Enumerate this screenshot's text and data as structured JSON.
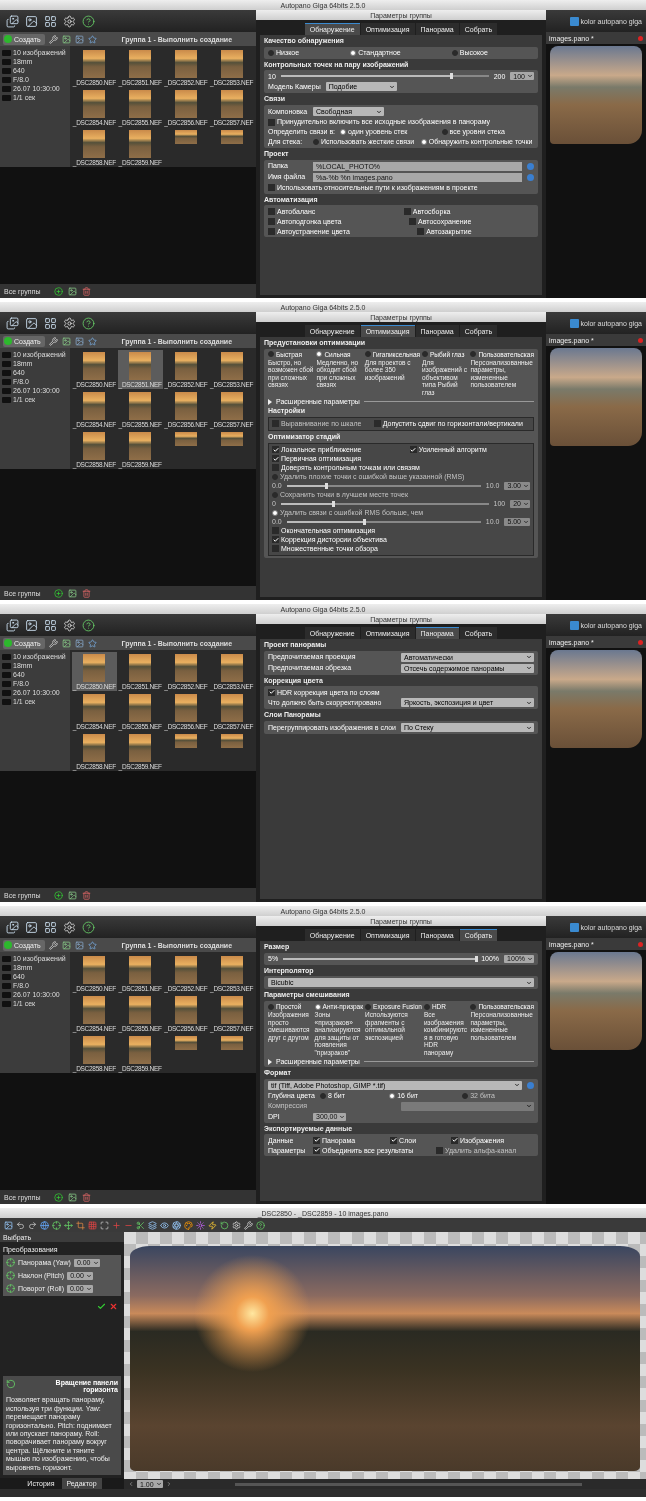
{
  "screens": [
    {
      "kind": "group-settings",
      "window_title": "Autopano Giga 64bits 2.5.0",
      "group_button": "Создать",
      "group_title": "Группа 1 - Выполнить создание",
      "info": [
        "10 изображений",
        "18mm",
        "640",
        "F/8.0",
        "26.07 10:30:00",
        "1/1 сек"
      ],
      "thumbnails": [
        {
          "label": "_DSC2850.NEF",
          "selected": false
        },
        {
          "label": "_DSC2851.NEF",
          "selected": false
        },
        {
          "label": "_DSC2852.NEF",
          "selected": false
        },
        {
          "label": "_DSC2853.NEF",
          "selected": false
        },
        {
          "label": "_DSC2854.NEF",
          "selected": false
        },
        {
          "label": "_DSC2855.NEF",
          "selected": false
        },
        {
          "label": "_DSC2856.NEF",
          "selected": false
        },
        {
          "label": "_DSC2857.NEF",
          "selected": false
        },
        {
          "label": "_DSC2858.NEF",
          "selected": false
        },
        {
          "label": "_DSC2859.NEF",
          "selected": false
        }
      ],
      "footer_label": "Все группы",
      "logo": "kolor autopano giga",
      "preview_title": "images.pano *",
      "dialog": {
        "title": "Параметры группы",
        "tabs": [
          {
            "label": "Обнаружение",
            "selected": true
          },
          {
            "label": "Оптимизация",
            "selected": false
          },
          {
            "label": "Панорама",
            "selected": false
          },
          {
            "label": "Собрать",
            "selected": false
          }
        ],
        "sections": [
          {
            "title": "Качество обнаружения",
            "rows": [
              {
                "kind": "radios",
                "options": [
                  {
                    "label": "Низкое",
                    "selected": false
                  },
                  {
                    "label": "Стандартное",
                    "selected": true
                  },
                  {
                    "label": "Высокое",
                    "selected": false
                  }
                ]
              }
            ]
          },
          {
            "title": "Контрольных точек на пару изображений",
            "rows": [
              {
                "kind": "slider",
                "min": "10",
                "max": "200",
                "level": 0.82,
                "value": "100"
              },
              {
                "kind": "select",
                "label": "Модель Камеры",
                "value": "Подобие",
                "narrow": true
              }
            ]
          },
          {
            "title": "Связи",
            "rows": [
              {
                "kind": "select",
                "label": "Компоновка",
                "value": "Свободная",
                "narrow": true
              },
              {
                "kind": "checks",
                "items": [
                  {
                    "label": "Принудительно включить все исходные изображения в панораму",
                    "checked": false
                  }
                ]
              },
              {
                "kind": "radios",
                "label": "Определить связи в:",
                "options": [
                  {
                    "label": "один уровень стек",
                    "selected": true
                  },
                  {
                    "label": "все уровни стека",
                    "selected": false
                  }
                ]
              },
              {
                "kind": "radios",
                "label": "Для стека:",
                "options": [
                  {
                    "label": "Использовать жесткие связи",
                    "selected": false
                  },
                  {
                    "label": "Обнаружить контрольные точки",
                    "selected": true
                  }
                ]
              }
            ]
          },
          {
            "title": "Проект",
            "rows": [
              {
                "kind": "field",
                "label": "Папка",
                "value": "%LOCAL_PHOTO%"
              },
              {
                "kind": "field",
                "label": "Имя файла",
                "value": "%a-%b %n images.pano"
              },
              {
                "kind": "checks",
                "items": [
                  {
                    "label": "Использовать относительные пути к изображениям в проекте",
                    "checked": false
                  }
                ]
              }
            ]
          },
          {
            "title": "Автоматизация",
            "rows": [
              {
                "kind": "checks",
                "items": [
                  {
                    "label": "Автобаланс",
                    "checked": false
                  },
                  {
                    "label": "Автосборка",
                    "checked": false
                  }
                ]
              },
              {
                "kind": "checks",
                "items": [
                  {
                    "label": "Автоподгонка цвета",
                    "checked": false
                  },
                  {
                    "label": "Автосохранение",
                    "checked": false
                  }
                ]
              },
              {
                "kind": "checks",
                "items": [
                  {
                    "label": "Автоустранение цвета",
                    "checked": false
                  },
                  {
                    "label": "Автозакрытие",
                    "checked": false
                  }
                ]
              }
            ]
          }
        ]
      }
    },
    {
      "kind": "group-settings",
      "window_title": "Autopano Giga 64bits 2.5.0",
      "group_button": "Создать",
      "group_title": "Группа 1 - Выполнить создание",
      "info": [
        "10 изображений",
        "18mm",
        "640",
        "F/8.0",
        "26.07 10:30:00",
        "1/1 сек"
      ],
      "thumbnails": [
        {
          "label": "_DSC2850.NEF",
          "selected": false
        },
        {
          "label": "_DSC2851.NEF",
          "selected": true
        },
        {
          "label": "_DSC2852.NEF",
          "selected": false
        },
        {
          "label": "_DSC2853.NEF",
          "selected": false
        },
        {
          "label": "_DSC2854.NEF",
          "selected": false
        },
        {
          "label": "_DSC2855.NEF",
          "selected": false
        },
        {
          "label": "_DSC2856.NEF",
          "selected": false
        },
        {
          "label": "_DSC2857.NEF",
          "selected": false
        },
        {
          "label": "_DSC2858.NEF",
          "selected": false
        },
        {
          "label": "_DSC2859.NEF",
          "selected": false
        }
      ],
      "footer_label": "Все группы",
      "logo": "kolor autopano giga",
      "preview_title": "images.pano *",
      "dialog": {
        "title": "Параметры группы",
        "tabs": [
          {
            "label": "Обнаружение",
            "selected": false
          },
          {
            "label": "Оптимизация",
            "selected": true
          },
          {
            "label": "Панорама",
            "selected": false
          },
          {
            "label": "Собрать",
            "selected": false
          }
        ],
        "sections": [
          {
            "title": "Предустановки оптимизации",
            "rows": [
              {
                "kind": "presets",
                "options": [
                  {
                    "label": "Быстрая",
                    "selected": false,
                    "description": "Быстро, но возможен сбой при сложных связях"
                  },
                  {
                    "label": "Сильная",
                    "selected": true,
                    "description": "Медленно, но обходит сбой при сложных связях"
                  },
                  {
                    "label": "Гигапиксельная",
                    "selected": false,
                    "description": "Для проектов с более 350 изображений"
                  },
                  {
                    "label": "Рыбий глаз",
                    "selected": false,
                    "description": "Для изображений с объективом типа Рыбий глаз"
                  },
                  {
                    "label": "Пользовательская",
                    "selected": false,
                    "description": "Персонализованные параметры, измененные пользователем"
                  }
                ]
              },
              {
                "kind": "expander",
                "label": "Расширенные параметры"
              },
              {
                "kind": "group",
                "title": "Настройки",
                "rows": [
                  {
                    "kind": "checks",
                    "items": [
                      {
                        "label": "Выравнивание по шкале",
                        "checked": false,
                        "disabled": true
                      },
                      {
                        "label": "Допустить сдвиг по горизонтали/вертикали",
                        "checked": false
                      }
                    ]
                  }
                ]
              },
              {
                "kind": "group",
                "title": "Оптимизатор стадий",
                "rows": [
                  {
                    "kind": "checks",
                    "items": [
                      {
                        "label": "Локальное приближение",
                        "checked": true
                      },
                      {
                        "label": "Усиленный алгоритм",
                        "checked": true
                      }
                    ]
                  },
                  {
                    "kind": "checks",
                    "items": [
                      {
                        "label": "Первичная оптимизация",
                        "checked": true
                      }
                    ]
                  },
                  {
                    "kind": "checks",
                    "items": [
                      {
                        "label": "Доверять контрольным точкам или связям",
                        "checked": false
                      }
                    ]
                  },
                  {
                    "kind": "radios",
                    "options": [
                      {
                        "label": "Удалить плохие точки с ошибкой выше указанной (RMS)",
                        "selected": false,
                        "disabled": true
                      }
                    ]
                  },
                  {
                    "kind": "slider",
                    "value": "3.00",
                    "min": "0.0",
                    "max": "10.0",
                    "level": 0.2,
                    "disabled": true
                  },
                  {
                    "kind": "radios",
                    "options": [
                      {
                        "label": "Сохранить точки в лучшем месте точек",
                        "selected": false,
                        "disabled": true
                      }
                    ]
                  },
                  {
                    "kind": "slider",
                    "value": "20",
                    "min": "0",
                    "max": "100",
                    "level": 0.25,
                    "disabled": true
                  },
                  {
                    "kind": "radios",
                    "options": [
                      {
                        "label": "Удалить связи с ошибкой RMS больше, чем",
                        "selected": true,
                        "disabled": true
                      }
                    ]
                  },
                  {
                    "kind": "slider",
                    "value": "5.00",
                    "min": "0.0",
                    "max": "10.0",
                    "level": 0.4,
                    "disabled": true
                  },
                  {
                    "kind": "checks",
                    "items": [
                      {
                        "label": "Окончательная оптимизация",
                        "checked": false
                      }
                    ]
                  },
                  {
                    "kind": "checks",
                    "items": [
                      {
                        "label": "Коррекция дисторсии объектива",
                        "checked": true
                      }
                    ]
                  },
                  {
                    "kind": "checks",
                    "items": [
                      {
                        "label": "Множественные точки обзора",
                        "checked": false
                      }
                    ]
                  }
                ]
              }
            ]
          }
        ]
      }
    },
    {
      "kind": "group-settings",
      "window_title": "Autopano Giga 64bits 2.5.0",
      "group_button": "Создать",
      "group_title": "Группа 1 - Выполнить создание",
      "info": [
        "10 изображений",
        "18mm",
        "640",
        "F/8.0",
        "26.07 10:30:00",
        "1/1 сек"
      ],
      "thumbnails": [
        {
          "label": "_DSC2850.NEF",
          "selected": true
        },
        {
          "label": "_DSC2851.NEF",
          "selected": false
        },
        {
          "label": "_DSC2852.NEF",
          "selected": false
        },
        {
          "label": "_DSC2853.NEF",
          "selected": false
        },
        {
          "label": "_DSC2854.NEF",
          "selected": false
        },
        {
          "label": "_DSC2855.NEF",
          "selected": false
        },
        {
          "label": "_DSC2856.NEF",
          "selected": false
        },
        {
          "label": "_DSC2857.NEF",
          "selected": false
        },
        {
          "label": "_DSC2858.NEF",
          "selected": false
        },
        {
          "label": "_DSC2859.NEF",
          "selected": false
        }
      ],
      "footer_label": "Все группы",
      "logo": "kolor autopano giga",
      "preview_title": "images.pano *",
      "dialog": {
        "title": "Параметры группы",
        "tabs": [
          {
            "label": "Обнаружение",
            "selected": false
          },
          {
            "label": "Оптимизация",
            "selected": false
          },
          {
            "label": "Панорама",
            "selected": true
          },
          {
            "label": "Собрать",
            "selected": false
          }
        ],
        "sections": [
          {
            "title": "Проект панорамы",
            "rows": [
              {
                "kind": "select",
                "label": "Предпочитаемая проекция",
                "value": "Автоматически"
              },
              {
                "kind": "select",
                "label": "Предпочитаемая обрезка",
                "value": "Отсечь содержимое панорамы"
              }
            ]
          },
          {
            "title": "Коррекция цвета",
            "rows": [
              {
                "kind": "checks",
                "items": [
                  {
                    "label": "HDR коррекция цвета по слоям",
                    "checked": true
                  }
                ]
              },
              {
                "kind": "select",
                "label": "Что должно быть скорректировано",
                "value": "Яркость, экспозиция и цвет"
              }
            ]
          },
          {
            "title": "Слои Панорамы",
            "rows": [
              {
                "kind": "select",
                "label": "Перегруппировать изображения в слои",
                "value": "По Стеку"
              }
            ]
          }
        ]
      }
    },
    {
      "kind": "group-settings",
      "window_title": "Autopano Giga 64bits 2.5.0",
      "group_button": "Создать",
      "group_title": "Группа 1 - Выполнить создание",
      "info": [
        "10 изображений",
        "18mm",
        "640",
        "F/8.0",
        "26.07 10:30:00",
        "1/1 сек"
      ],
      "thumbnails": [
        {
          "label": "_DSC2850.NEF",
          "selected": false
        },
        {
          "label": "_DSC2851.NEF",
          "selected": false
        },
        {
          "label": "_DSC2852.NEF",
          "selected": false
        },
        {
          "label": "_DSC2853.NEF",
          "selected": false
        },
        {
          "label": "_DSC2854.NEF",
          "selected": false
        },
        {
          "label": "_DSC2855.NEF",
          "selected": false
        },
        {
          "label": "_DSC2856.NEF",
          "selected": false
        },
        {
          "label": "_DSC2857.NEF",
          "selected": false
        },
        {
          "label": "_DSC2858.NEF",
          "selected": false
        },
        {
          "label": "_DSC2859.NEF",
          "selected": false
        }
      ],
      "footer_label": "Все группы",
      "logo": "kolor autopano giga",
      "preview_title": "images.pano *",
      "dialog": {
        "title": "Параметры группы",
        "tabs": [
          {
            "label": "Обнаружение",
            "selected": false
          },
          {
            "label": "Оптимизация",
            "selected": false
          },
          {
            "label": "Панорама",
            "selected": false
          },
          {
            "label": "Собрать",
            "selected": true
          }
        ],
        "sections": [
          {
            "title": "Размер",
            "rows": [
              {
                "kind": "slider",
                "min": "5%",
                "max": "100%",
                "level": 1.0,
                "value": "100%"
              }
            ]
          },
          {
            "title": "Интерполятор",
            "rows": [
              {
                "kind": "select",
                "value": "Bicubic"
              }
            ]
          },
          {
            "title": "Параметры смешивания",
            "rows": [
              {
                "kind": "presets",
                "options": [
                  {
                    "label": "Простой",
                    "selected": false,
                    "description": "Изображения просто смешиваются друг с другом"
                  },
                  {
                    "label": "Анти-призрак",
                    "selected": true,
                    "description": "Зоны «призраков» анализируются для защиты от появления \"призраков\""
                  },
                  {
                    "label": "Exposure Fusion",
                    "selected": false,
                    "description": "Используются фрагменты с оптимальной экспозицией"
                  },
                  {
                    "label": "HDR",
                    "selected": false,
                    "description": "Все изображения комбинируются в готовую HDR панораму"
                  },
                  {
                    "label": "Пользовательская",
                    "selected": false,
                    "description": "Персонализованные параметры, измененные пользователем"
                  }
                ]
              },
              {
                "kind": "expander",
                "label": "Расширенные параметры"
              }
            ]
          },
          {
            "title": "Формат",
            "rows": [
              {
                "kind": "select",
                "value": "tif (Tiff, Adobe Photoshop, GIMP *.tif)",
                "help": true
              },
              {
                "kind": "radios",
                "label": "Глубина цвета",
                "options": [
                  {
                    "label": "8 бит",
                    "selected": false
                  },
                  {
                    "label": "16 бит",
                    "selected": true
                  },
                  {
                    "label": "32 бита",
                    "selected": false,
                    "disabled": true
                  }
                ]
              },
              {
                "kind": "select",
                "label": "Компрессия",
                "value": "",
                "disabled": true
              },
              {
                "kind": "spin",
                "label": "DPI",
                "value": "300,00"
              }
            ]
          },
          {
            "title": "Экспортируемые данные",
            "rows": [
              {
                "kind": "checks",
                "label": "Данные",
                "items": [
                  {
                    "label": "Панорама",
                    "checked": true
                  },
                  {
                    "label": "Слои",
                    "checked": true
                  },
                  {
                    "label": "Изображения",
                    "checked": true
                  }
                ]
              },
              {
                "kind": "checks",
                "label": "Параметры",
                "items": [
                  {
                    "label": "Объединить все результаты",
                    "checked": true
                  },
                  {
                    "label": "Удалить альфа-канал",
                    "checked": false,
                    "disabled": true
                  }
                ]
              }
            ]
          }
        ]
      }
    },
    {
      "kind": "editor",
      "window_title": "_DSC2850 - _DSC2859 - 10 images.pano",
      "panel_title": "Выбрать",
      "group_title": "Преобразования",
      "transforms": [
        {
          "label": "Панорама (Yaw)",
          "value": "0.00"
        },
        {
          "label": "Наклон (Pitch)",
          "value": "0.00"
        },
        {
          "label": "Поворот (Roll)",
          "value": "0.00"
        }
      ],
      "help_title": "Вращение панели горизонта",
      "help_text": "Позволяет вращать панораму, используя три функции. Yaw: перемещает панораму горизонтально. Pitch: поднимает или опускает панораму. Roll: поворачивает панораму вокруг центра. Щёлкните и тяните мышью по изображению, чтобы выровнять горизонт.",
      "tabs": [
        {
          "label": "История",
          "selected": false
        },
        {
          "label": "Редактор",
          "selected": true
        }
      ],
      "zoom_value": "1.00"
    }
  ]
}
